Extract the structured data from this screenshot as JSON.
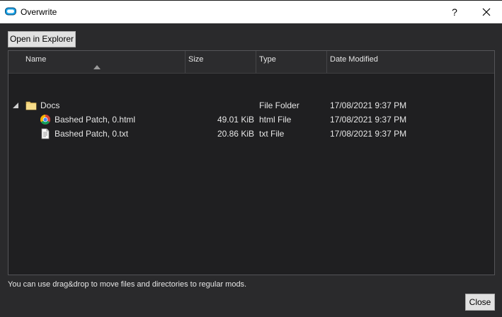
{
  "window": {
    "title": "Overwrite",
    "help_label": "?",
    "app_icon": "mo2-logo-icon",
    "close_icon": "close-icon"
  },
  "toolbar": {
    "open_in_explorer_label": "Open in Explorer"
  },
  "tree": {
    "columns": {
      "name": "Name",
      "size": "Size",
      "type": "Type",
      "date": "Date Modified"
    },
    "sort": {
      "column": "Name",
      "indicator": "sort-up-icon"
    },
    "rows": [
      {
        "name": "Docs",
        "size": "",
        "type": "File Folder",
        "date": "17/08/2021 9:37 PM",
        "icon": "folder-icon",
        "expanded": true,
        "depth": 0
      },
      {
        "name": "Bashed Patch, 0.html",
        "size": "49.01 KiB",
        "type": "html File",
        "date": "17/08/2021 9:37 PM",
        "icon": "chrome-html-icon",
        "depth": 1
      },
      {
        "name": "Bashed Patch, 0.txt",
        "size": "20.86 KiB",
        "type": "txt File",
        "date": "17/08/2021 9:37 PM",
        "icon": "text-file-icon",
        "depth": 1
      }
    ]
  },
  "footer": {
    "hint": "You can use drag&drop to move files and directories to regular mods.",
    "close_label": "Close"
  },
  "colors": {
    "background": "#2a2a2c",
    "tree_background": "#1f1f21",
    "text": "#e6e6e6",
    "folder": "#f2d27a",
    "mo2_blue": "#1aa3e8"
  }
}
